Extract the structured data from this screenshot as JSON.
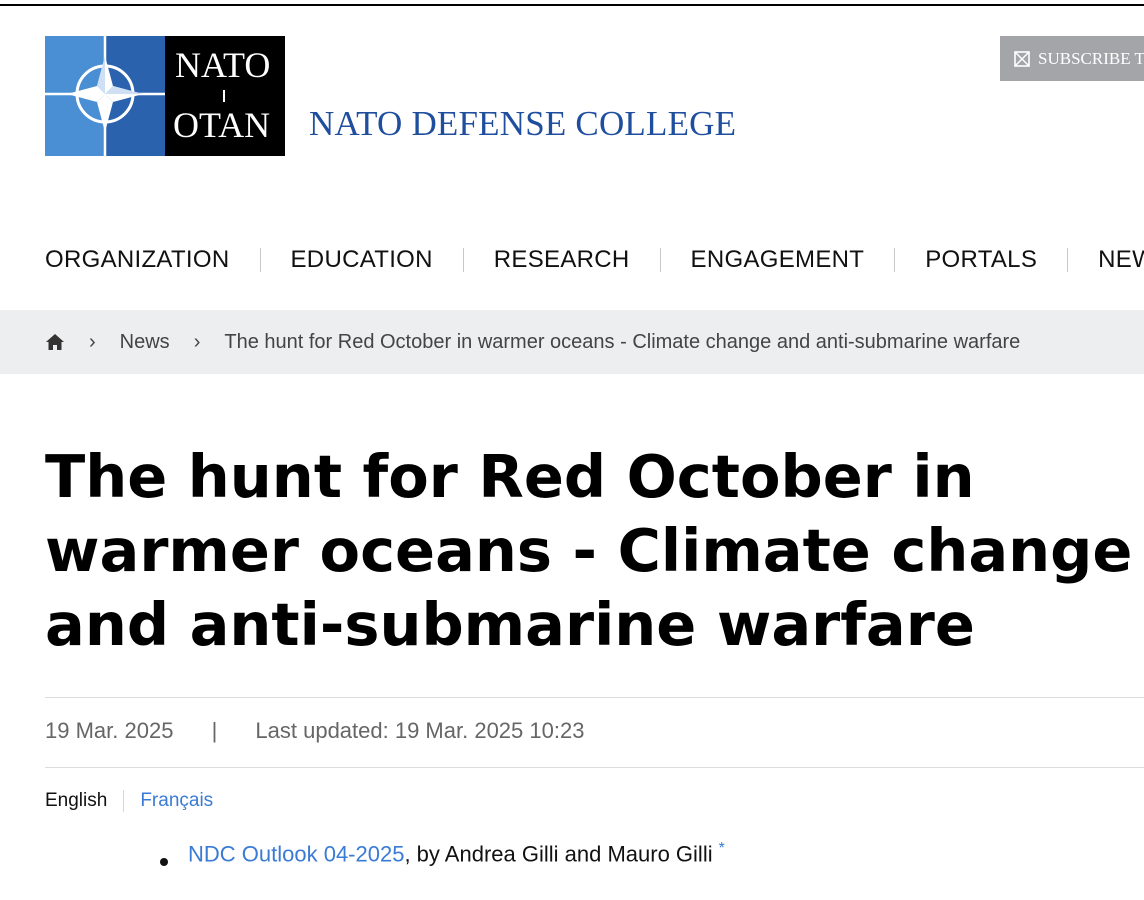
{
  "logo": {
    "top_text": "NATO",
    "bottom_text": "OTAN",
    "college_name": "NATO DEFENSE COLLEGE",
    "colors": {
      "dark_blue": "#2a62ae",
      "light_blue": "#4a8fd4",
      "black": "#000000",
      "brand_text": "#1f4e9e"
    }
  },
  "header": {
    "subscribe_label": "SUBSCRIBE T",
    "subscribe_icon": "envelope-icon"
  },
  "nav": {
    "items": [
      {
        "label": "ORGANIZATION"
      },
      {
        "label": "EDUCATION"
      },
      {
        "label": "RESEARCH"
      },
      {
        "label": "ENGAGEMENT"
      },
      {
        "label": "PORTALS"
      },
      {
        "label": "NEWSLE"
      }
    ]
  },
  "breadcrumb": {
    "home_icon": "home-icon",
    "separator": "›",
    "items": [
      {
        "label": "News"
      },
      {
        "label": "The hunt for Red October in warmer oceans - Climate change and anti-submarine warfare"
      }
    ]
  },
  "article": {
    "title": "The hunt for Red October in warmer oceans - Climate change and anti-submarine warfare",
    "date": "19 Mar. 2025",
    "separator": "|",
    "last_updated": "Last updated: 19 Mar. 2025 10:23",
    "languages": [
      {
        "label": "English",
        "active": true
      },
      {
        "label": "Français",
        "active": false
      }
    ],
    "bullets": [
      {
        "link_text": "NDC Outlook 04-2025",
        "rest": ", by Andrea Gilli and Mauro Gilli",
        "footnote_mark": "*"
      }
    ]
  },
  "colors": {
    "link": "#3a7bd5",
    "breadcrumb_bg": "#eceef0",
    "subscribe_bg": "#a3a5a8"
  }
}
